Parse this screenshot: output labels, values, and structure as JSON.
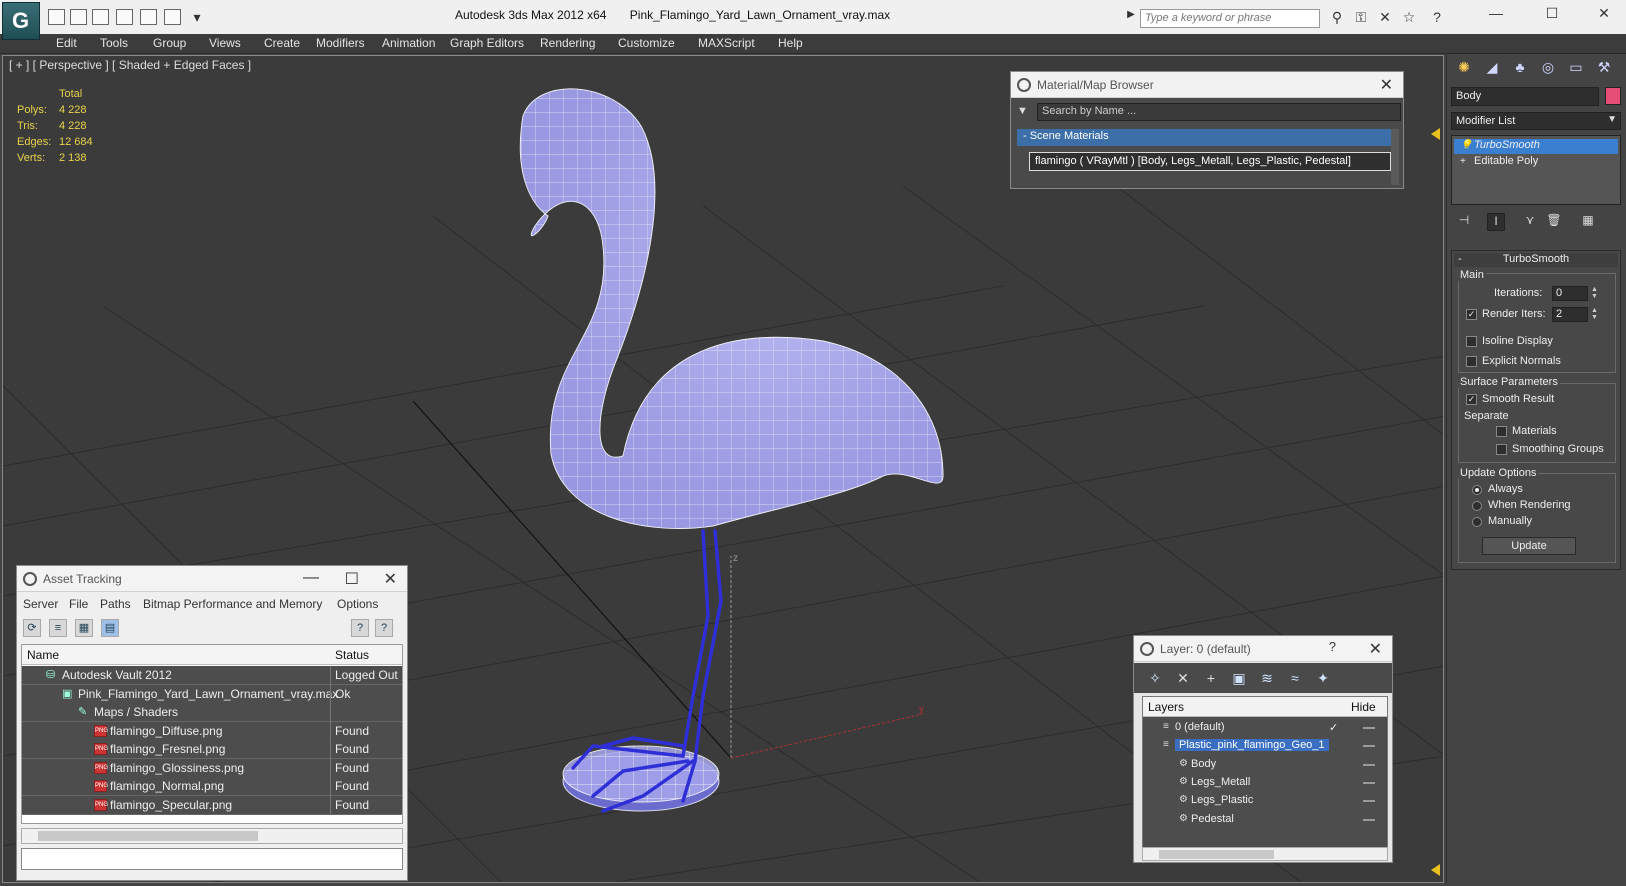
{
  "titlebar": {
    "app_name": "Autodesk 3ds Max  2012 x64",
    "file_name": "Pink_Flamingo_Yard_Lawn_Ornament_vray.max",
    "search_placeholder": "Type a keyword or phrase",
    "logo_glyph": "G"
  },
  "menu": {
    "items": [
      "Edit",
      "Tools",
      "Group",
      "Views",
      "Create",
      "Modifiers",
      "Animation",
      "Graph Editors",
      "Rendering",
      "Customize",
      "MAXScript",
      "Help"
    ]
  },
  "viewport": {
    "label": "[ + ] [ Perspective ] [ Shaded + Edged Faces ]",
    "stats": {
      "header": "Total",
      "polys_label": "Polys:",
      "polys": "4 228",
      "tris_label": "Tris:",
      "tris": "4 228",
      "edges_label": "Edges:",
      "edges": "12 684",
      "verts_label": "Verts:",
      "verts": "2 138"
    },
    "axis_labels": {
      "z": "z",
      "y": "y"
    },
    "colors": {
      "mesh_fill": "#a9a8ee",
      "mesh_edge": "#ffffff",
      "legs": "#2f2fd8",
      "grid": "#2a2a2a"
    }
  },
  "material_browser": {
    "title": "Material/Map Browser",
    "search_placeholder": "Search by Name ...",
    "section": "- Scene Materials",
    "material_entry": "flamingo  ( VRayMtl ) [Body, Legs_Metall, Legs_Plastic, Pedestal]"
  },
  "asset_tracking": {
    "title": "Asset Tracking",
    "menu": [
      "Server",
      "File",
      "Paths",
      "Bitmap Performance and Memory",
      "Options"
    ],
    "columns": {
      "name": "Name",
      "status": "Status"
    },
    "rows": [
      {
        "name": "Autodesk Vault 2012",
        "status": "Logged Out",
        "indent": 1,
        "icon": "vault-icon"
      },
      {
        "name": "Pink_Flamingo_Yard_Lawn_Ornament_vray.max",
        "status": "Ok",
        "indent": 2,
        "icon": "max-file-icon"
      },
      {
        "name": "Maps / Shaders",
        "status": "",
        "indent": 3,
        "icon": "maps-icon"
      },
      {
        "name": "flamingo_Diffuse.png",
        "status": "Found",
        "indent": 4,
        "icon": "png-icon"
      },
      {
        "name": "flamingo_Fresnel.png",
        "status": "Found",
        "indent": 4,
        "icon": "png-icon"
      },
      {
        "name": "flamingo_Glossiness.png",
        "status": "Found",
        "indent": 4,
        "icon": "png-icon"
      },
      {
        "name": "flamingo_Normal.png",
        "status": "Found",
        "indent": 4,
        "icon": "png-icon"
      },
      {
        "name": "flamingo_Specular.png",
        "status": "Found",
        "indent": 4,
        "icon": "png-icon"
      }
    ]
  },
  "layer_manager": {
    "title": "Layer: 0 (default)",
    "help": "?",
    "columns": {
      "layers": "Layers",
      "hide": "Hide"
    },
    "rows": [
      {
        "name": "0 (default)",
        "indent": 1,
        "selected": false
      },
      {
        "name": "Plastic_pink_flamingo_Geo_1",
        "indent": 1,
        "selected": true
      },
      {
        "name": "Body",
        "indent": 2,
        "selected": false
      },
      {
        "name": "Legs_Metall",
        "indent": 2,
        "selected": false
      },
      {
        "name": "Legs_Plastic",
        "indent": 2,
        "selected": false
      },
      {
        "name": "Pedestal",
        "indent": 2,
        "selected": false
      }
    ]
  },
  "command_panel": {
    "object_name": "Body",
    "object_color": "#e64d77",
    "modifier_list": "Modifier List",
    "stack": [
      "TurboSmooth",
      "Editable Poly"
    ],
    "turbosmooth": {
      "title": "TurboSmooth",
      "main_label": "Main",
      "iterations_label": "Iterations:",
      "iterations": "0",
      "render_iters_label": "Render Iters:",
      "render_iters": "2",
      "isoline_label": "Isoline Display",
      "explicit_normals_label": "Explicit Normals",
      "surface_params_label": "Surface Parameters",
      "smooth_result_label": "Smooth Result",
      "separate_label": "Separate",
      "materials_label": "Materials",
      "smoothing_groups_label": "Smoothing Groups",
      "update_options_label": "Update Options",
      "always_label": "Always",
      "when_rendering_label": "When Rendering",
      "manually_label": "Manually",
      "update_button": "Update"
    }
  }
}
